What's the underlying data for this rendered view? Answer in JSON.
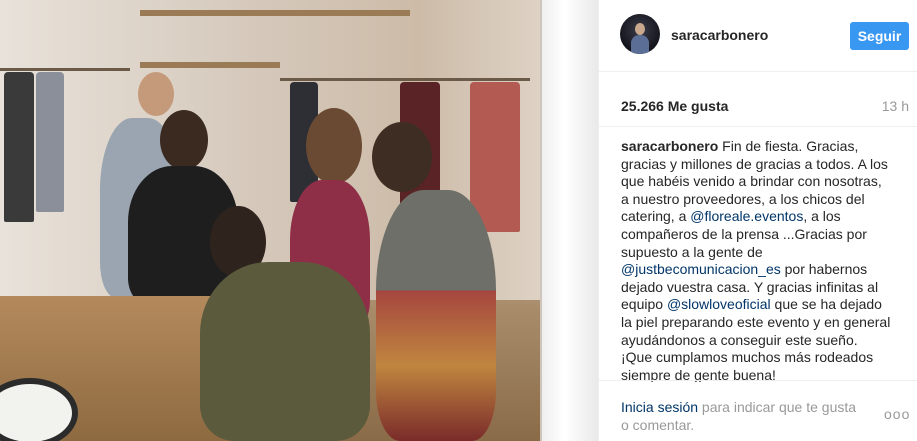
{
  "post": {
    "username": "saracarbonero",
    "follow_label": "Seguir",
    "likes": "25.266 Me gusta",
    "time": "13 h",
    "caption": {
      "username": "saracarbonero",
      "part1": " Fin de fiesta. Gracias, gracias y millones de gracias a todos. A los que habéis venido a brindar con nosotras, a nuestro proveedores, a los chicos del catering, a ",
      "link1": "@floreale.eventos",
      "part2": ", a los compañeros de la prensa ...Gracias por supuesto a la gente de ",
      "link2": "@justbecomunicacion_es",
      "part3": " por habernos dejado vuestra casa. Y gracias infinitas al equipo ",
      "link3": "@slowloveoficial",
      "part4": " que se ha dejado la piel preparando este evento y en general ayudándonos a conseguir este sueño. ¡Que cumplamos muchos más rodeados siempre de gente buena!"
    },
    "footer": {
      "login_link": "Inicia sesión",
      "login_rest": " para indicar que te gusta o comentar.",
      "more_label": "ooo"
    }
  },
  "icons": {
    "avatar": "profile-avatar",
    "more": "more-options-icon"
  },
  "colors": {
    "follow_button": "#3897f0",
    "link": "#003569",
    "muted": "#999999"
  }
}
